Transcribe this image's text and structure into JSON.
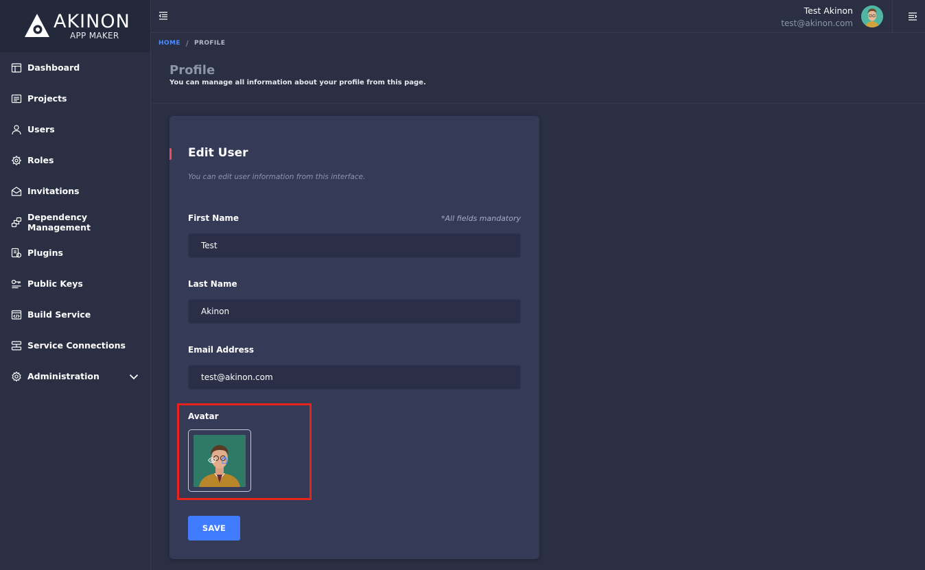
{
  "brand": {
    "name": "AKINON",
    "sub": "APP MAKER"
  },
  "sidebar": {
    "items": [
      {
        "label": "Dashboard",
        "icon": "dashboard-icon"
      },
      {
        "label": "Projects",
        "icon": "projects-icon"
      },
      {
        "label": "Users",
        "icon": "user-icon"
      },
      {
        "label": "Roles",
        "icon": "roles-icon"
      },
      {
        "label": "Invitations",
        "icon": "invitation-icon"
      },
      {
        "label": "Dependency Management",
        "icon": "dependency-icon"
      },
      {
        "label": "Plugins",
        "icon": "plugin-icon"
      },
      {
        "label": "Public Keys",
        "icon": "key-icon"
      },
      {
        "label": "Build Service",
        "icon": "code-icon"
      },
      {
        "label": "Service Connections",
        "icon": "connection-icon"
      },
      {
        "label": "Administration",
        "icon": "gear-icon",
        "expandable": true
      }
    ]
  },
  "topbar": {
    "user_name": "Test Akinon",
    "user_email": "test@akinon.com"
  },
  "breadcrumb": {
    "home": "HOME",
    "separator": "/",
    "current": "PROFILE"
  },
  "page": {
    "title": "Profile",
    "subtitle": "You can manage all information about your profile from this page."
  },
  "form": {
    "title": "Edit User",
    "subtitle": "You can edit user information from this interface.",
    "mandatory_note": "*All fields mandatory",
    "first_name": {
      "label": "First Name",
      "value": "Test"
    },
    "last_name": {
      "label": "Last Name",
      "value": "Akinon"
    },
    "email": {
      "label": "Email Address",
      "value": "test@akinon.com"
    },
    "avatar": {
      "label": "Avatar"
    },
    "save_label": "SAVE"
  },
  "colors": {
    "background": "#2a2f43",
    "card": "#353a57",
    "accent": "#3f7cff",
    "title_accent": "#ee4b5f",
    "highlight": "#e8241d"
  }
}
